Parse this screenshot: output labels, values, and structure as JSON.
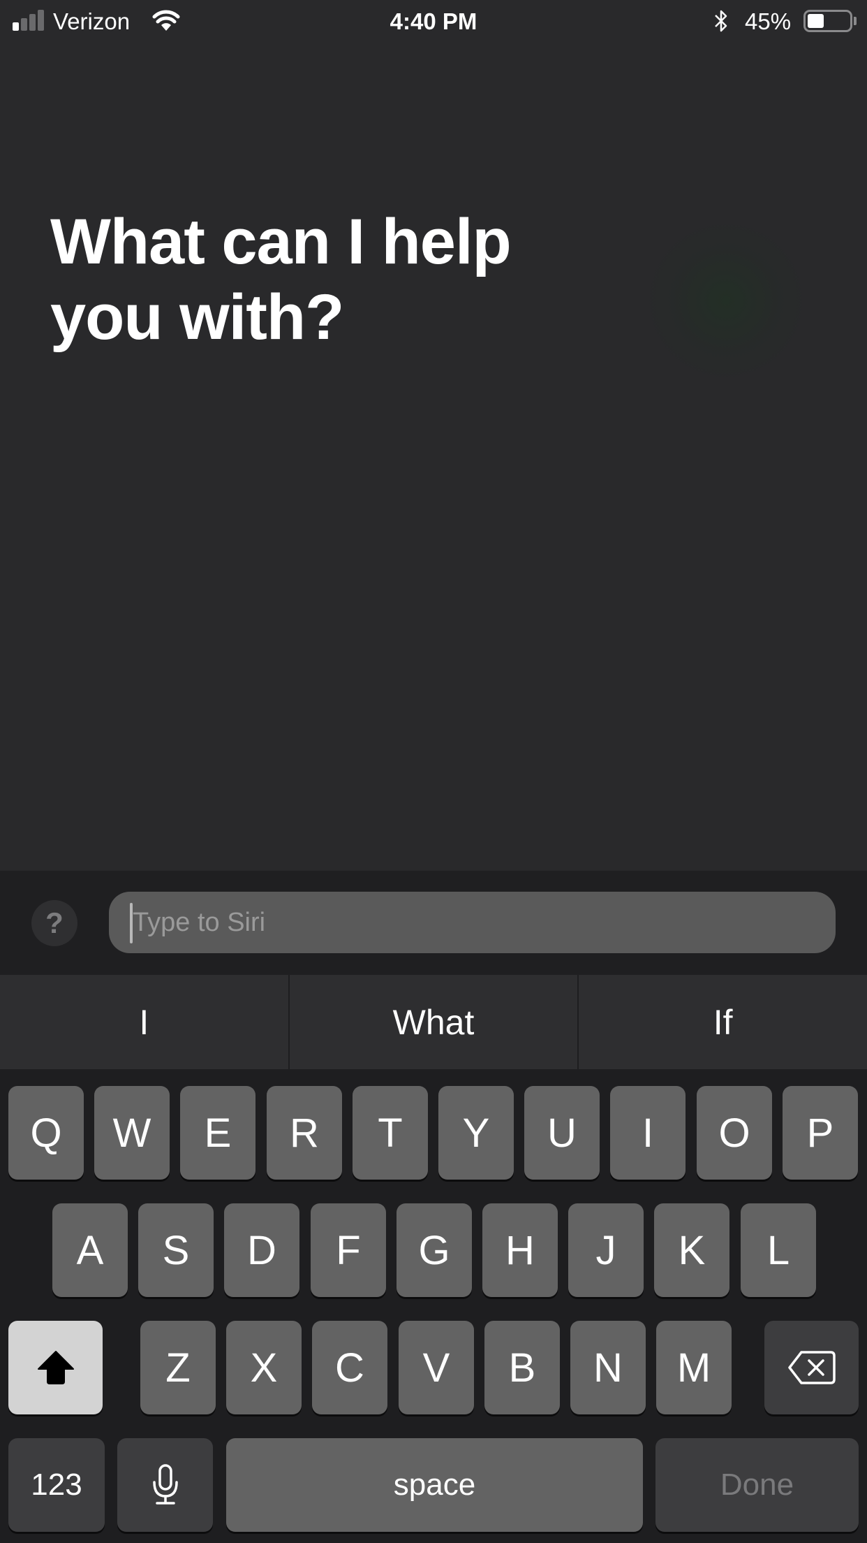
{
  "status_bar": {
    "carrier": "Verizon",
    "signal_bars_filled": 1,
    "signal_bars_total": 4,
    "wifi_icon": "wifi-icon",
    "time": "4:40 PM",
    "bluetooth_icon": "bluetooth-icon",
    "battery_percent_text": "45%",
    "battery_level": 0.45
  },
  "main": {
    "prompt": "What can I help you with?"
  },
  "siri_bar": {
    "help_label": "?",
    "input_placeholder": "Type to Siri",
    "input_value": ""
  },
  "suggestions": [
    "I",
    "What",
    "If"
  ],
  "keyboard": {
    "row1": [
      "Q",
      "W",
      "E",
      "R",
      "T",
      "Y",
      "U",
      "I",
      "O",
      "P"
    ],
    "row2": [
      "A",
      "S",
      "D",
      "F",
      "G",
      "H",
      "J",
      "K",
      "L"
    ],
    "row3": [
      "Z",
      "X",
      "C",
      "V",
      "B",
      "N",
      "M"
    ],
    "shift_icon": "shift-arrow-icon",
    "delete_icon": "backspace-icon",
    "numbers_label": "123",
    "mic_icon": "microphone-icon",
    "space_label": "space",
    "done_label": "Done"
  },
  "colors": {
    "background": "#29292b",
    "keyboard_bg": "#1e1e20",
    "key": "#636363",
    "key_dark": "#3d3d3f",
    "shift_active": "#d3d3d3",
    "input_bg": "#5a5a5a"
  }
}
